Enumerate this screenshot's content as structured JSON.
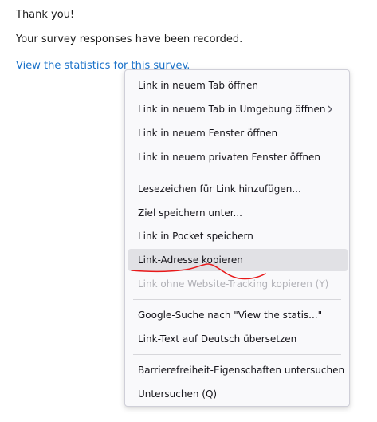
{
  "page": {
    "thanks": "Thank you!",
    "recorded": "Your survey responses have been recorded.",
    "stats_link": "View the statistics for this survey."
  },
  "context_menu": {
    "items": [
      {
        "label": "Link in neuem Tab öffnen"
      },
      {
        "label": "Link in neuem Tab in Umgebung öffnen",
        "submenu": true
      },
      {
        "label": "Link in neuem Fenster öffnen"
      },
      {
        "label": "Link in neuem privaten Fenster öffnen"
      },
      {
        "label": "Lesezeichen für Link hinzufügen..."
      },
      {
        "label": "Ziel speichern unter..."
      },
      {
        "label": "Link in Pocket speichern"
      },
      {
        "label": "Link-Adresse kopieren",
        "state": "hovered"
      },
      {
        "label": "Link ohne Website-Tracking kopieren (Y)",
        "state": "disabled"
      },
      {
        "label": "Google-Suche nach \"View the statis...\""
      },
      {
        "label": "Link-Text auf Deutsch übersetzen"
      },
      {
        "label": "Barrierefreiheit-Eigenschaften untersuchen"
      },
      {
        "label": "Untersuchen (Q)"
      }
    ],
    "submenu_icon": "chevron-right-icon"
  },
  "annotation": {
    "color": "#e8191a",
    "type": "hand-drawn underline"
  }
}
